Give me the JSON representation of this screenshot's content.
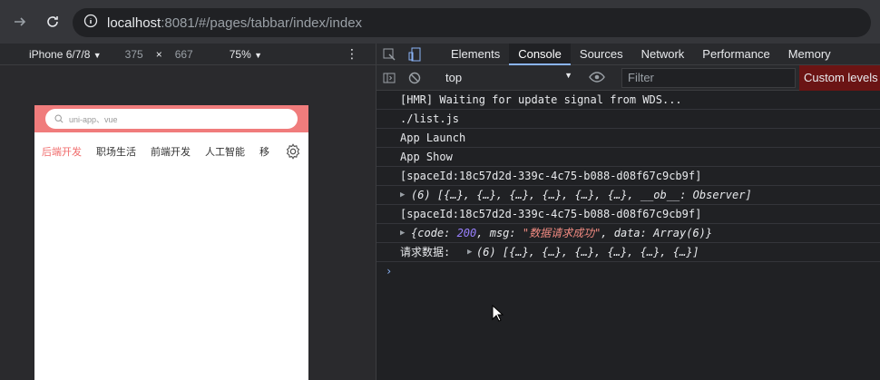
{
  "browser": {
    "url_host": "localhost",
    "url_rest": ":8081/#/pages/tabbar/index/index"
  },
  "device_toolbar": {
    "device": "iPhone 6/7/8",
    "width": "375",
    "times": "×",
    "height": "667",
    "zoom": "75%"
  },
  "app": {
    "search_placeholder": "uni-app、vue",
    "tabs": [
      "后端开发",
      "职场生活",
      "前端开发",
      "人工智能",
      "移"
    ],
    "accent_color": "#f07c7c"
  },
  "devtools": {
    "tabs": [
      "Elements",
      "Console",
      "Sources",
      "Network",
      "Performance",
      "Memory"
    ],
    "active_tab": "Console",
    "context": "top",
    "filter_placeholder": "Filter",
    "levels": "Custom levels"
  },
  "console": {
    "lines": [
      "[HMR] Waiting for update signal from WDS...",
      "./list.js",
      "App Launch",
      "App Show",
      "[spaceId:18c57d2d-339c-4c75-b088-d08f67c9cb9f]",
      "(6) [{…}, {…}, {…}, {…}, {…}, {…}, __ob__: Observer]",
      "[spaceId:18c57d2d-339c-4c75-b088-d08f67c9cb9f]"
    ],
    "obj_prefix": "{code: ",
    "obj_code": "200",
    "obj_mid": ", msg: ",
    "obj_msg": "\"数据请求成功\"",
    "obj_end": ", data: Array(6)}",
    "req_label": "请求数据:",
    "req_value": "(6) [{…}, {…}, {…}, {…}, {…}, {…}]"
  }
}
